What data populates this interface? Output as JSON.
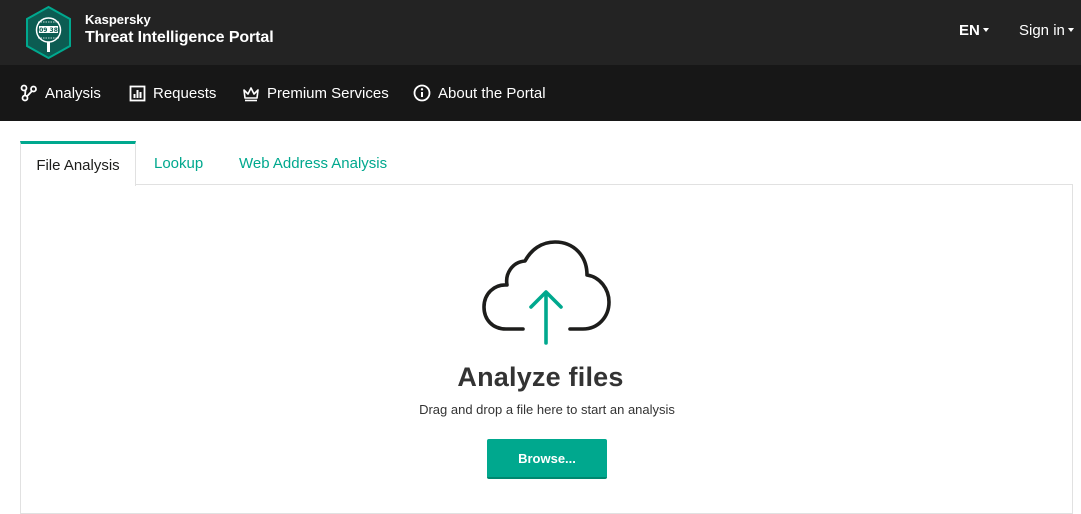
{
  "header": {
    "brand_small": "Kaspersky",
    "brand_title": "Threat Intelligence Portal",
    "language": "EN",
    "signin": "Sign in"
  },
  "nav": {
    "items": [
      {
        "label": "Analysis",
        "icon": "analysis-graph-icon"
      },
      {
        "label": "Requests",
        "icon": "requests-chart-icon"
      },
      {
        "label": "Premium Services",
        "icon": "crown-icon"
      },
      {
        "label": "About the Portal",
        "icon": "info-icon"
      }
    ]
  },
  "tabs": [
    {
      "label": "File Analysis",
      "active": true
    },
    {
      "label": "Lookup",
      "active": false
    },
    {
      "label": "Web Address Analysis",
      "active": false
    }
  ],
  "upload": {
    "icon": "cloud-upload-icon",
    "title": "Analyze files",
    "subtitle": "Drag and drop a file here to start an analysis",
    "button": "Browse..."
  },
  "colors": {
    "accent": "#00a88e",
    "header_bg": "#232323",
    "nav_bg": "#171717"
  }
}
